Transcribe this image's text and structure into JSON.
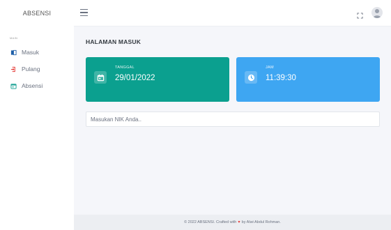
{
  "sidebar": {
    "brand": "ABSENSI",
    "heading": "MAIN",
    "items": [
      {
        "label": "Masuk",
        "icon": "login-icon",
        "color": "#1e5fa8"
      },
      {
        "label": "Pulang",
        "icon": "logout-icon",
        "color": "#e53935"
      },
      {
        "label": "Absensi",
        "icon": "calendar-icon",
        "color": "#26a69a"
      }
    ]
  },
  "topbar": {
    "menu_icon": "hamburger-icon",
    "fullscreen_icon": "fullscreen-icon",
    "avatar_icon": "user-avatar-icon"
  },
  "main": {
    "title": "HALAMAN MASUK",
    "cards": [
      {
        "label": "TANGGAL",
        "value": "29/01/2022",
        "icon": "calendar-icon",
        "color": "#0ba08f"
      },
      {
        "label": "JAM",
        "value": "11:39:30",
        "icon": "clock-icon",
        "color": "#3ea6f2"
      }
    ],
    "nik_input": {
      "placeholder": "Masukan NIK Anda..",
      "value": ""
    }
  },
  "footer": {
    "text_before": "© 2022 ABSENSI. Crafted with",
    "heart": "♥",
    "text_after": "by Alwi Abdul Rohman."
  }
}
